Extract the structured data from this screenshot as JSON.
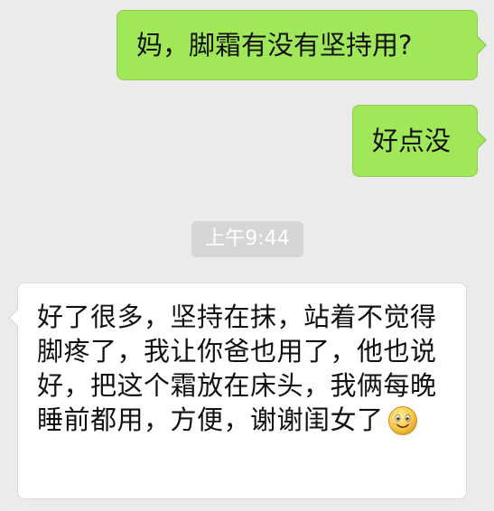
{
  "conversation": {
    "messages": [
      {
        "direction": "sent",
        "text": "妈，脚霜有没有坚持用?"
      },
      {
        "direction": "sent",
        "text": "好点没"
      },
      {
        "direction": "received",
        "text": "好了很多，坚持在抹，站着不觉得脚疼了，我让你爸也用了，他也说好，把这个霜放在床头，我俩每晚睡前都用，方便，谢谢闺女了",
        "emoji": "smiley-face-icon"
      }
    ],
    "timestamp": "上午9:44"
  },
  "colors": {
    "background": "#ebebeb",
    "sent_bubble": "#a0e75a",
    "received_bubble": "#ffffff",
    "timestamp_pill": "#d6d6d6"
  }
}
